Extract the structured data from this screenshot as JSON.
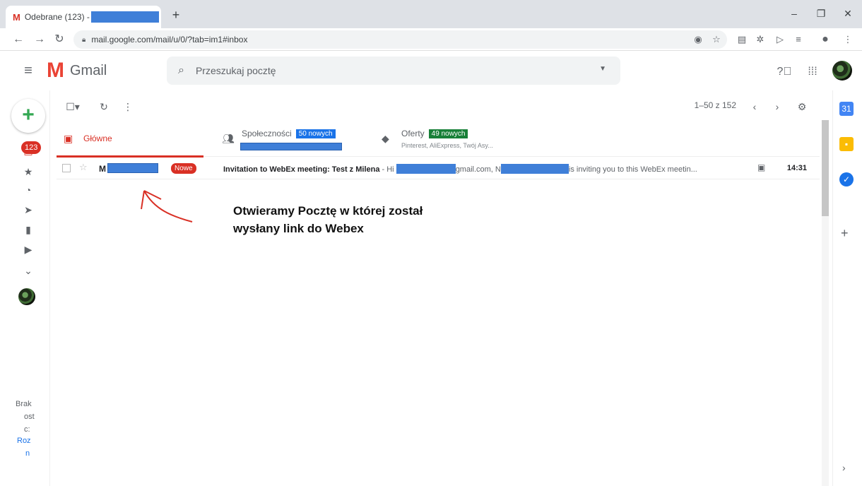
{
  "browser": {
    "tab_title": "Odebrane (123) -",
    "new_tab": "+",
    "url": "mail.google.com/mail/u/0/?tab=im1#inbox",
    "window_controls": [
      "–",
      "❐",
      "✕"
    ]
  },
  "header": {
    "app_name": "Gmail",
    "search_placeholder": "Przeszukaj pocztę"
  },
  "rail": {
    "inbox_count": "123",
    "hangouts_text": [
      "Brak",
      "ost",
      "c:",
      "Roz",
      "n"
    ]
  },
  "toolbar": {
    "pager": "1–50 z 152"
  },
  "tabs": [
    {
      "label": "Główne",
      "active": true,
      "icon": "inbox-icon"
    },
    {
      "label": "Społeczności",
      "badge": "50 nowych",
      "badge_color": "#1a73e8",
      "icon": "people-icon"
    },
    {
      "label": "Oferty",
      "badge": "49 nowych",
      "badge_color": "#188038",
      "sub": "Pinterest, AliExpress, Twój Asy...",
      "icon": "tag-icon"
    }
  ],
  "emails": [
    {
      "sender": "M",
      "label": "Nowe",
      "subject": "Invitation to WebEx meeting: Test z Milena",
      "snippet_a": " - Hi ",
      "snippet_b": "gmail.com, N",
      "snippet_c": "is inviting you to this WebEx meetin...",
      "time": "14:31"
    }
  ],
  "annotation": {
    "line1": "Otwieramy Pocztę w której został",
    "line2": "wysłany link do Webex"
  },
  "colors": {
    "gmail_red": "#d93025",
    "redaction": "#3f7fd8"
  }
}
